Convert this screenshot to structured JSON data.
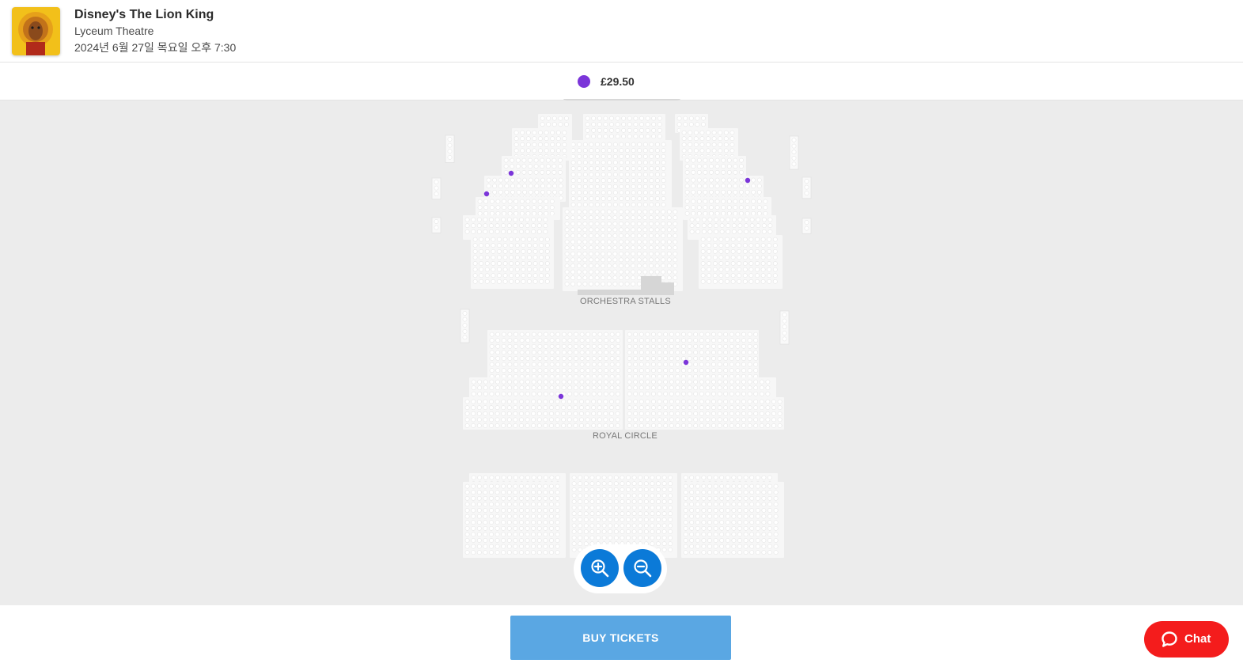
{
  "event": {
    "title": "Disney's The Lion King",
    "venue": "Lyceum Theatre",
    "datetime": "2024년 6월 27일 목요일 오후 7:30"
  },
  "legend": {
    "price": "£29.50",
    "color": "#7b35d9"
  },
  "map": {
    "sections": [
      {
        "label": "ORCHESTRA STALLS"
      },
      {
        "label": "ROYAL CIRCLE"
      }
    ],
    "available_seat_color": "#7b35d9",
    "seat_color": "#ffffff",
    "background_color": "#ececec"
  },
  "zoom": {
    "in_icon": "zoom-in-icon",
    "out_icon": "zoom-out-icon"
  },
  "footer": {
    "buy_label": "BUY TICKETS",
    "chat_label": "Chat",
    "chat_icon": "chat-bubble-icon",
    "buy_color": "#5aa7e3",
    "chat_color": "#f41c1c"
  }
}
